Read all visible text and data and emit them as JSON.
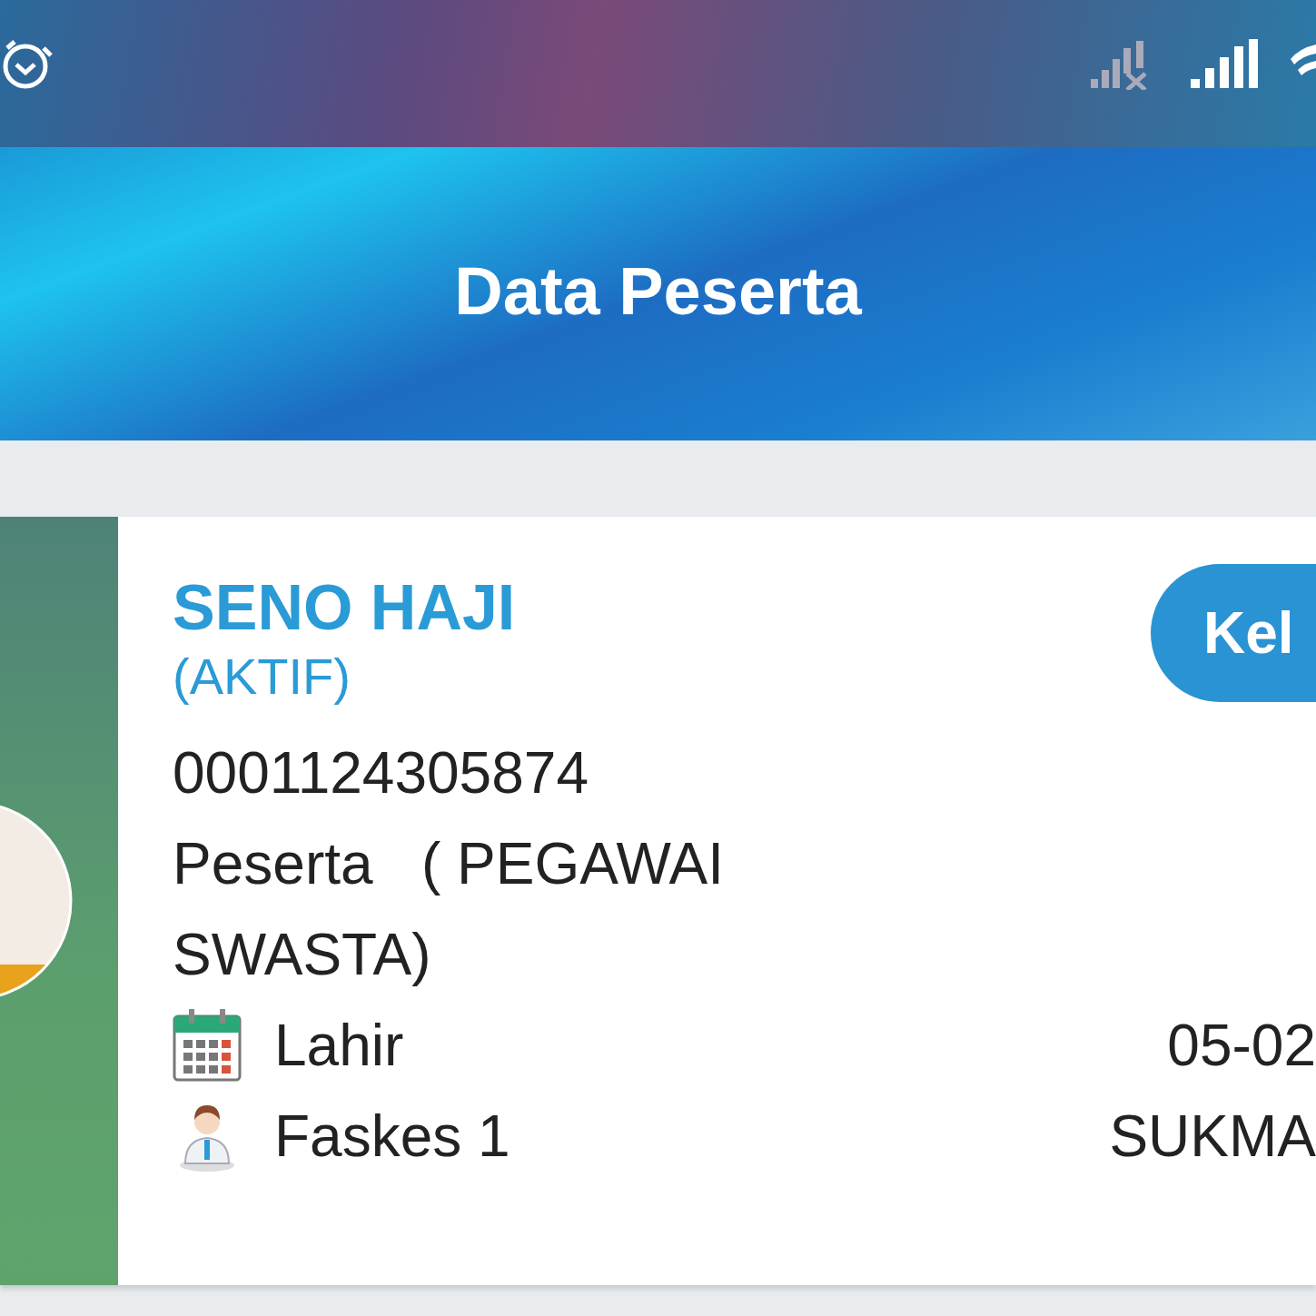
{
  "header": {
    "title": "Data Peserta"
  },
  "participant": {
    "name": "SENO HAJI",
    "status": "(AKTIF)",
    "card_number": "0001124305874",
    "type": "Peserta   ( PEGAWAI SWASTA)",
    "class_badge": "Kel",
    "details": [
      {
        "kind": "calendar",
        "label": "Lahir",
        "value": "05-02"
      },
      {
        "kind": "doctor",
        "label": "Faskes 1",
        "value": "SUKMA"
      }
    ]
  }
}
